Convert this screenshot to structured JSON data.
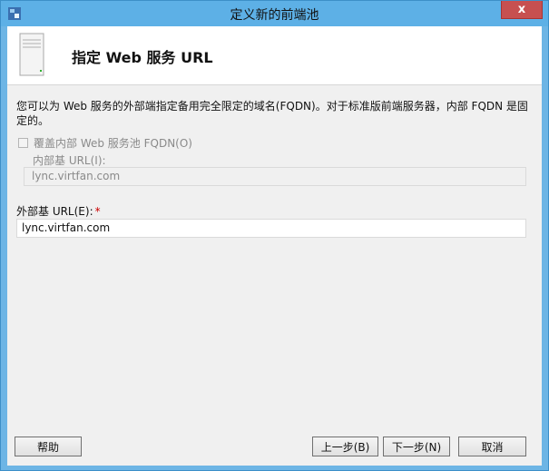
{
  "window": {
    "title": "定义新的前端池",
    "close_glyph": "x"
  },
  "header": {
    "title": "指定 Web 服务 URL"
  },
  "description": "您可以为 Web 服务的外部端指定备用完全限定的域名(FQDN)。对于标准版前端服务器，内部 FQDN 是固定的。",
  "override_checkbox": {
    "label": "覆盖内部 Web 服务池 FQDN(O)",
    "checked": false
  },
  "internal_url": {
    "label": "内部基 URL(I):",
    "value": "lync.virtfan.com"
  },
  "external_url": {
    "label": "外部基 URL(E):",
    "required_mark": "*",
    "value": "lync.virtfan.com"
  },
  "buttons": {
    "help": "帮助",
    "back": "上一步(B)",
    "next": "下一步(N)",
    "cancel": "取消"
  },
  "colors": {
    "titlebar": "#5db0e6",
    "close": "#c75050",
    "required": "#cc0000"
  },
  "icons": {
    "app": "lync-app-icon",
    "header": "server-icon"
  }
}
